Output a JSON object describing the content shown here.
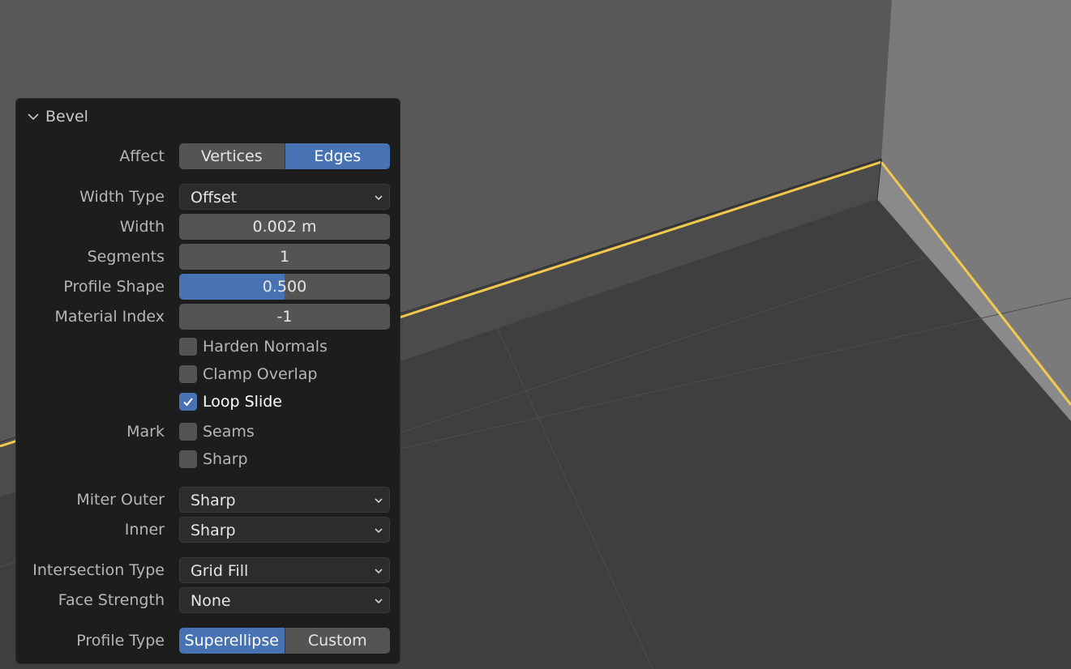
{
  "panel": {
    "title": "Bevel",
    "affect": {
      "label": "Affect",
      "options": [
        "Vertices",
        "Edges"
      ],
      "selected": "Edges"
    },
    "width_type": {
      "label": "Width Type",
      "value": "Offset"
    },
    "width": {
      "label": "Width",
      "value": "0.002 m"
    },
    "segments": {
      "label": "Segments",
      "value": "1"
    },
    "profile_shape": {
      "label": "Profile Shape",
      "value": "0.500",
      "fill_fraction": 0.5
    },
    "material_index": {
      "label": "Material Index",
      "value": "-1"
    },
    "harden_normals": {
      "label": "Harden Normals",
      "checked": false
    },
    "clamp_overlap": {
      "label": "Clamp Overlap",
      "checked": false
    },
    "loop_slide": {
      "label": "Loop Slide",
      "checked": true
    },
    "mark": {
      "label": "Mark",
      "seams": {
        "label": "Seams",
        "checked": false
      },
      "sharp": {
        "label": "Sharp",
        "checked": false
      }
    },
    "miter_outer": {
      "label": "Miter Outer",
      "value": "Sharp"
    },
    "miter_inner": {
      "label": "Inner",
      "value": "Sharp"
    },
    "intersection_type": {
      "label": "Intersection Type",
      "value": "Grid Fill"
    },
    "face_strength": {
      "label": "Face Strength",
      "value": "None"
    },
    "profile_type": {
      "label": "Profile Type",
      "options": [
        "Superellipse",
        "Custom"
      ],
      "selected": "Superellipse"
    }
  },
  "colors": {
    "accent": "#4772b3",
    "panel_bg": "#1d1d1d",
    "field_bg": "#545454",
    "selected_edge": "#f2c94c"
  },
  "icons": {
    "collapse": "chevron-down-icon",
    "dropdown": "chevron-down-icon",
    "check": "checkmark-icon"
  }
}
